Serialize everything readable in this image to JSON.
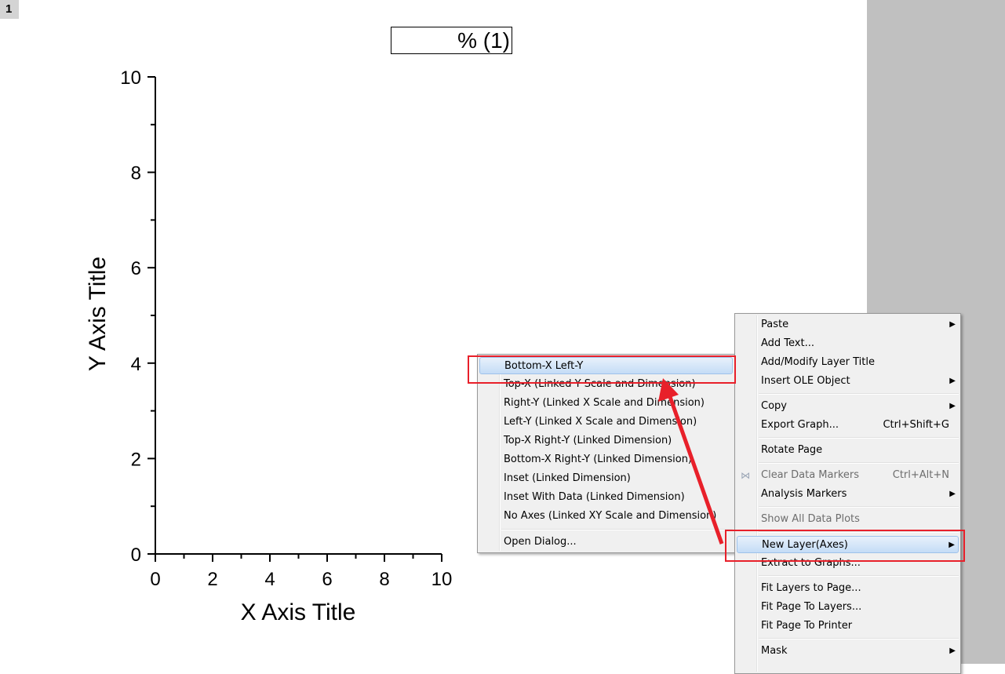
{
  "layer_badge": "1",
  "graph_title": "% (1)",
  "plot": {
    "x_title": "X Axis Title",
    "y_title": "Y Axis Title",
    "x_ticks": [
      "0",
      "2",
      "4",
      "6",
      "8",
      "10"
    ],
    "y_ticks": [
      "0",
      "2",
      "4",
      "6",
      "8",
      "10"
    ]
  },
  "context_menu": {
    "items": [
      {
        "label": "Paste",
        "shortcut": "",
        "submenu": true,
        "disabled": false
      },
      {
        "label": "Add Text...",
        "shortcut": "",
        "submenu": false,
        "disabled": false
      },
      {
        "label": "Add/Modify Layer Title",
        "shortcut": "",
        "submenu": false,
        "disabled": false
      },
      {
        "label": "Insert OLE Object",
        "shortcut": "",
        "submenu": true,
        "disabled": false
      },
      {
        "label": "Copy",
        "shortcut": "",
        "submenu": true,
        "disabled": false
      },
      {
        "label": "Export Graph...",
        "shortcut": "Ctrl+Shift+G",
        "submenu": false,
        "disabled": false
      },
      {
        "label": "Rotate Page",
        "shortcut": "",
        "submenu": false,
        "disabled": false
      },
      {
        "label": "Clear Data Markers",
        "shortcut": "Ctrl+Alt+N",
        "submenu": false,
        "disabled": true
      },
      {
        "label": "Analysis Markers",
        "shortcut": "",
        "submenu": true,
        "disabled": false
      },
      {
        "label": "Show All Data Plots",
        "shortcut": "",
        "submenu": false,
        "disabled": true
      },
      {
        "label": "New Layer(Axes)",
        "shortcut": "",
        "submenu": true,
        "disabled": false,
        "highlighted": true
      },
      {
        "label": "Extract to Graphs...",
        "shortcut": "",
        "submenu": false,
        "disabled": false
      },
      {
        "label": "Fit Layers to Page...",
        "shortcut": "",
        "submenu": false,
        "disabled": false
      },
      {
        "label": "Fit Page To Layers...",
        "shortcut": "",
        "submenu": false,
        "disabled": false
      },
      {
        "label": "Fit Page To Printer",
        "shortcut": "",
        "submenu": false,
        "disabled": false
      },
      {
        "label": "Mask",
        "shortcut": "",
        "submenu": true,
        "disabled": false
      }
    ]
  },
  "submenu": {
    "items": [
      {
        "label": "Bottom-X Left-Y",
        "highlighted": true
      },
      {
        "label": "Top-X (Linked Y Scale and Dimension)"
      },
      {
        "label": "Right-Y (Linked X Scale and Dimension)"
      },
      {
        "label": "Left-Y (Linked X Scale and Dimension)"
      },
      {
        "label": "Top-X Right-Y (Linked Dimension)"
      },
      {
        "label": "Bottom-X Right-Y (Linked Dimension)"
      },
      {
        "label": "Inset (Linked Dimension)"
      },
      {
        "label": "Inset With Data (Linked Dimension)"
      },
      {
        "label": "No Axes (Linked XY Scale and Dimension)"
      },
      {
        "label": "Open Dialog..."
      }
    ]
  },
  "colors": {
    "annotation_red": "#e8202a",
    "page_margin": "#c0c0c0",
    "highlight": "#c4dcf6"
  }
}
